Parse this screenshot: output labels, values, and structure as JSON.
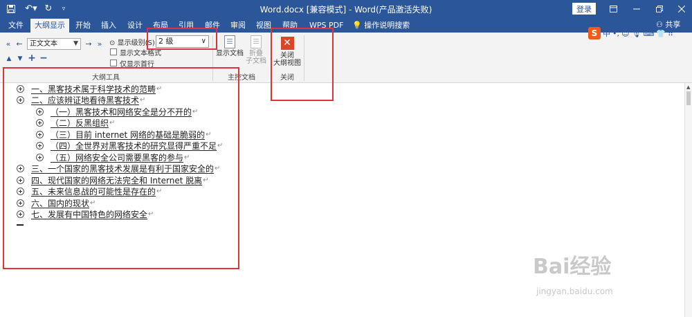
{
  "title_bar": {
    "doc_title": "Word.docx [兼容模式] - Word(产品激活失败)",
    "login": "登录",
    "save_icon": "save-icon",
    "undo_icon": "undo-icon",
    "redo_icon": "redo-icon",
    "customize_icon": "qat-customize-icon"
  },
  "tabs": [
    "文件",
    "大纲显示",
    "开始",
    "插入",
    "设计",
    "布局",
    "引用",
    "邮件",
    "审阅",
    "视图",
    "帮助",
    "WPS PDF",
    "操作说明搜索"
  ],
  "active_tab": "大纲显示",
  "share": "共享",
  "ribbon": {
    "style_value": "正文文本",
    "show_level_label": "显示级别(S):",
    "show_level_value": "2 级",
    "show_text_format": "显示文本格式",
    "show_first_line": "仅显示首行",
    "outline_tools_label": "大纲工具",
    "show_document": "显示文档",
    "collapse_subdoc_line1": "折叠",
    "collapse_subdoc_line2": "子文档",
    "master_doc_label": "主控文档",
    "close_outline_line1": "关闭",
    "close_outline_line2": "大纲视图",
    "close_label": "关闭"
  },
  "ime": {
    "mode": "中",
    "punct": "•,"
  },
  "outline": [
    {
      "level": 1,
      "text": "一、黑客技术属于科学技术的范畴"
    },
    {
      "level": 1,
      "text": "二、应该辨证地看待黑客技术"
    },
    {
      "level": 2,
      "text": "（一）黑客技术和网络安全是分不开的"
    },
    {
      "level": 2,
      "text": "（二）反黑组织"
    },
    {
      "level": 2,
      "text": "（三）目前 internet 网络的基础是脆弱的"
    },
    {
      "level": 2,
      "text": "（四）全世界对黑客技术的研究显得严重不足"
    },
    {
      "level": 2,
      "text": "（五）网络安全公司需要黑客的参与"
    },
    {
      "level": 1,
      "text": "三、一个国家的黑客技术发展是有利于国家安全的"
    },
    {
      "level": 1,
      "text": "四、现代国家的网络无法完全和 Internet 脱离"
    },
    {
      "level": 1,
      "text": "五、未来信息战的可能性是存在的"
    },
    {
      "level": 1,
      "text": "六、国内的现状"
    },
    {
      "level": 1,
      "text": "七、发展有中国特色的网络安全"
    }
  ],
  "paragraph_mark": "↵",
  "watermark": {
    "brand": "Bai经验",
    "url": "jingyan.baidu.com"
  },
  "colors": {
    "accent": "#2b579a",
    "highlight_box": "#e0323b",
    "close_button": "#d9472b"
  }
}
